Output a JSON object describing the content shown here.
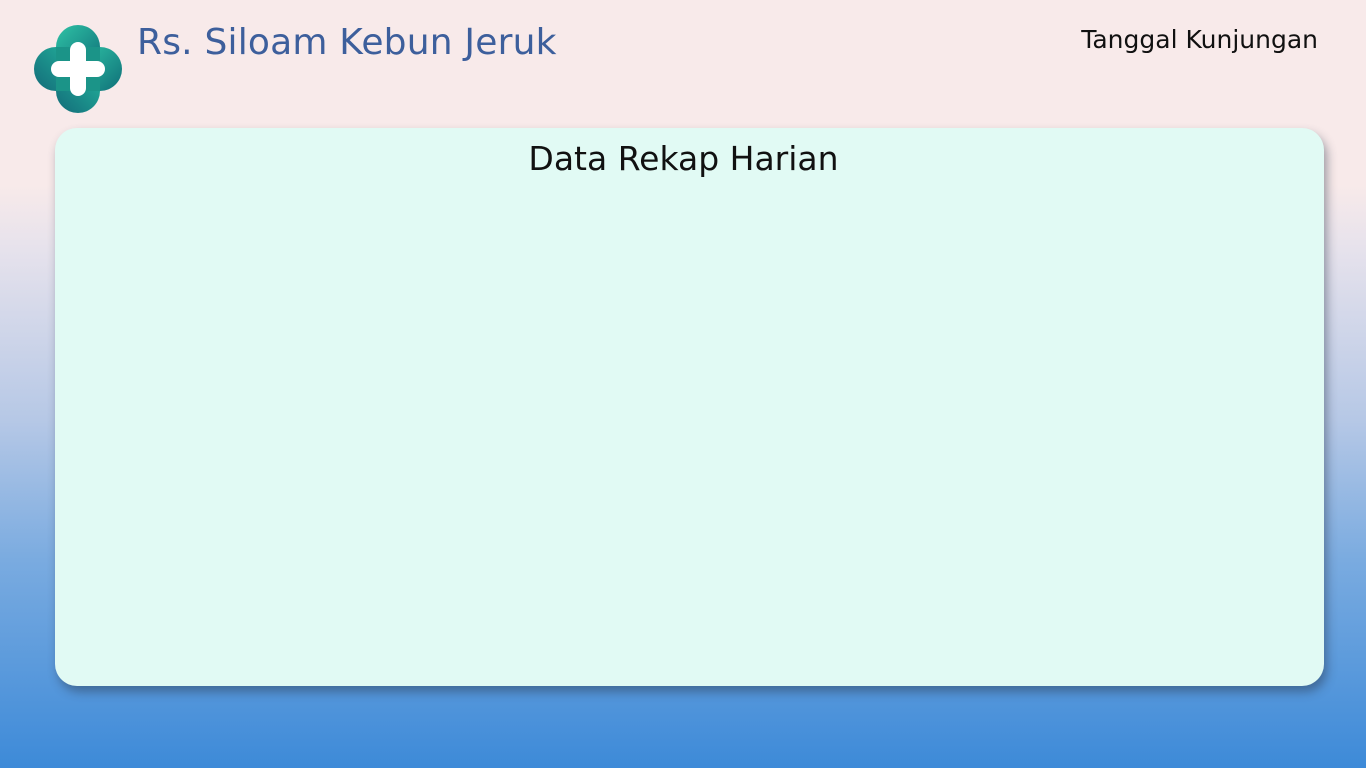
{
  "header": {
    "logo_icon": "medical-cross-icon",
    "title": "Rs. Siloam Kebun Jeruk",
    "nav_link": "Tanggal Kunjungan"
  },
  "panel": {
    "title": "Data Rekap Harian"
  },
  "colors": {
    "brand_title": "#3d5f9c",
    "logo_teal_dark": "#127a70",
    "logo_teal_light": "#2bc0a4",
    "panel_background": "#e1faf4",
    "page_gradient_top": "#f8eaea",
    "page_gradient_bottom": "#3d8ad8"
  }
}
